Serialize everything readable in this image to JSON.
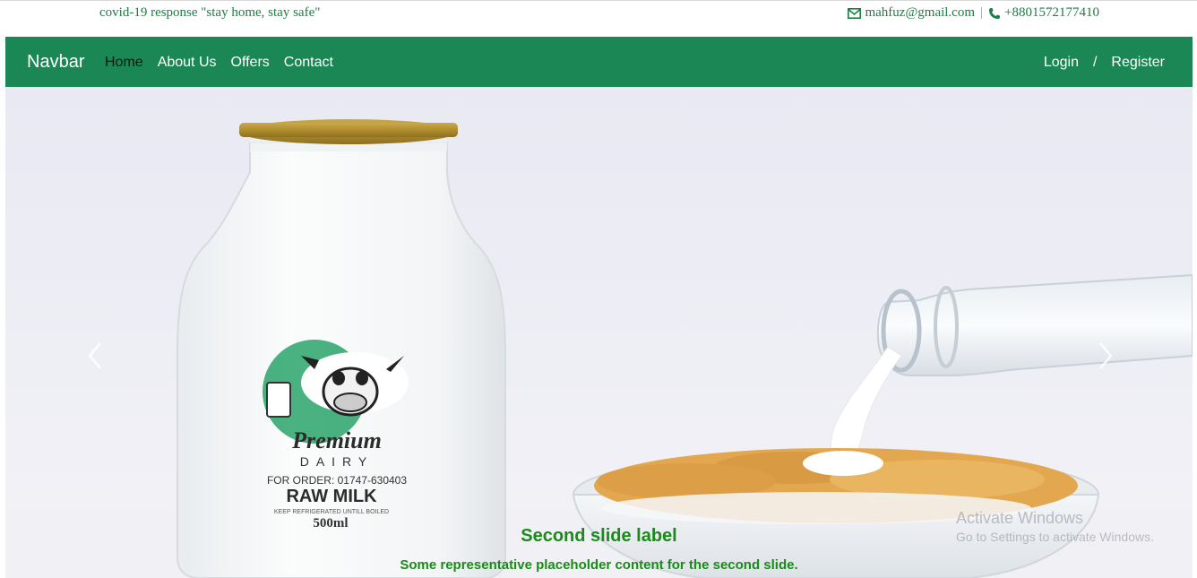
{
  "topbar": {
    "tagline": "covid-19 response \"stay home, stay safe\"",
    "email": "mahfuz@gmail.com",
    "separator": "|",
    "phone": "+8801572177410",
    "color": "#1a7f43"
  },
  "navbar": {
    "brand": "Navbar",
    "links": [
      "Home",
      "About Us",
      "Offers",
      "Contact"
    ],
    "active": "Home",
    "login": "Login",
    "slash": "/",
    "register": "Register",
    "bg_color": "#1b8755"
  },
  "carousel": {
    "label_title": "Second slide label",
    "label_text": "Some representative placeholder content for the second slide.",
    "caption_color": "#1a8a1a",
    "bottle_brand_line1": "Premium",
    "bottle_brand_line2": "DAIRY",
    "bottle_order": "FOR ORDER: 01747-630403",
    "bottle_product": "RAW MILK",
    "bottle_note": "KEEP REFRIGERATED UNTILL BOILED",
    "bottle_volume": "500ml"
  },
  "watermark": {
    "line1": "Activate Windows",
    "line2": "Go to Settings to activate Windows."
  }
}
